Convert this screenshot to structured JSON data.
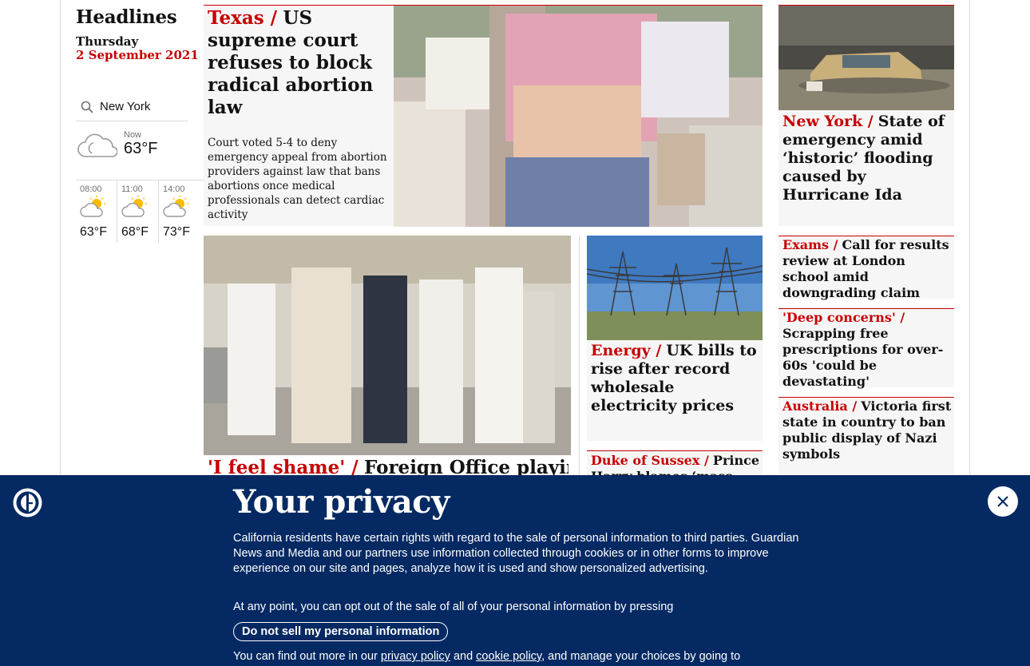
{
  "sidebar": {
    "title": "Headlines",
    "day": "Thursday",
    "date": "2 September 2021",
    "weather": {
      "city": "New York",
      "now_label": "Now",
      "now_temp": "63°F",
      "forecast": [
        {
          "time": "08:00",
          "temp": "63°F"
        },
        {
          "time": "11:00",
          "temp": "68°F"
        },
        {
          "time": "14:00",
          "temp": "73°F"
        }
      ]
    }
  },
  "stories": {
    "texas": {
      "kicker": "Texas /",
      "headline": "US supreme court refuses to block radical abortion law",
      "standfirst": "Court voted 5-4 to deny emergency appeal from abortion providers against law that bans abortions once medical professionals can detect cardiac activity"
    },
    "new_york": {
      "kicker": "New York /",
      "headline": "State of emergency amid ‘historic’ flooding caused by Hurricane Ida"
    },
    "feature": {
      "kicker": "'I feel shame' /",
      "headline": "Foreign Office playing"
    },
    "energy": {
      "kicker": "Energy /",
      "headline": "UK bills to rise after record wholesale electricity prices"
    },
    "sussex": {
      "kicker": "Duke of Sussex /",
      "headline": "Prince Harry blames ‘mass"
    },
    "exams": {
      "kicker": "Exams /",
      "headline": "Call for results review at London school amid downgrading claim"
    },
    "deep_concerns": {
      "kicker": "'Deep concerns'  /",
      "headline": "Scrapping free prescriptions for over-60s 'could be devastating'"
    },
    "australia": {
      "kicker": "Australia /",
      "headline": "Victoria first state in country to ban public display of Nazi symbols"
    }
  },
  "privacy": {
    "title": "Your privacy",
    "body": "California residents have certain rights with regard to the sale of personal information to third parties. Guardian News and Media and our partners use information collected through cookies or in other forms to improve experience on our site and pages, analyze how it is used and show personalized advertising.",
    "line2": "At any point, you can opt out of the sale of all of your personal information by pressing",
    "button": "Do not sell my personal information",
    "line3_pre": "You can find out more in our",
    "link1": "privacy policy",
    "line3_and": "and",
    "link2": "cookie policy",
    "line3_post": ", and manage your choices by going to"
  },
  "colors": {
    "accent": "#c70000",
    "banner": "#052962",
    "card_bg": "#f6f6f6"
  }
}
